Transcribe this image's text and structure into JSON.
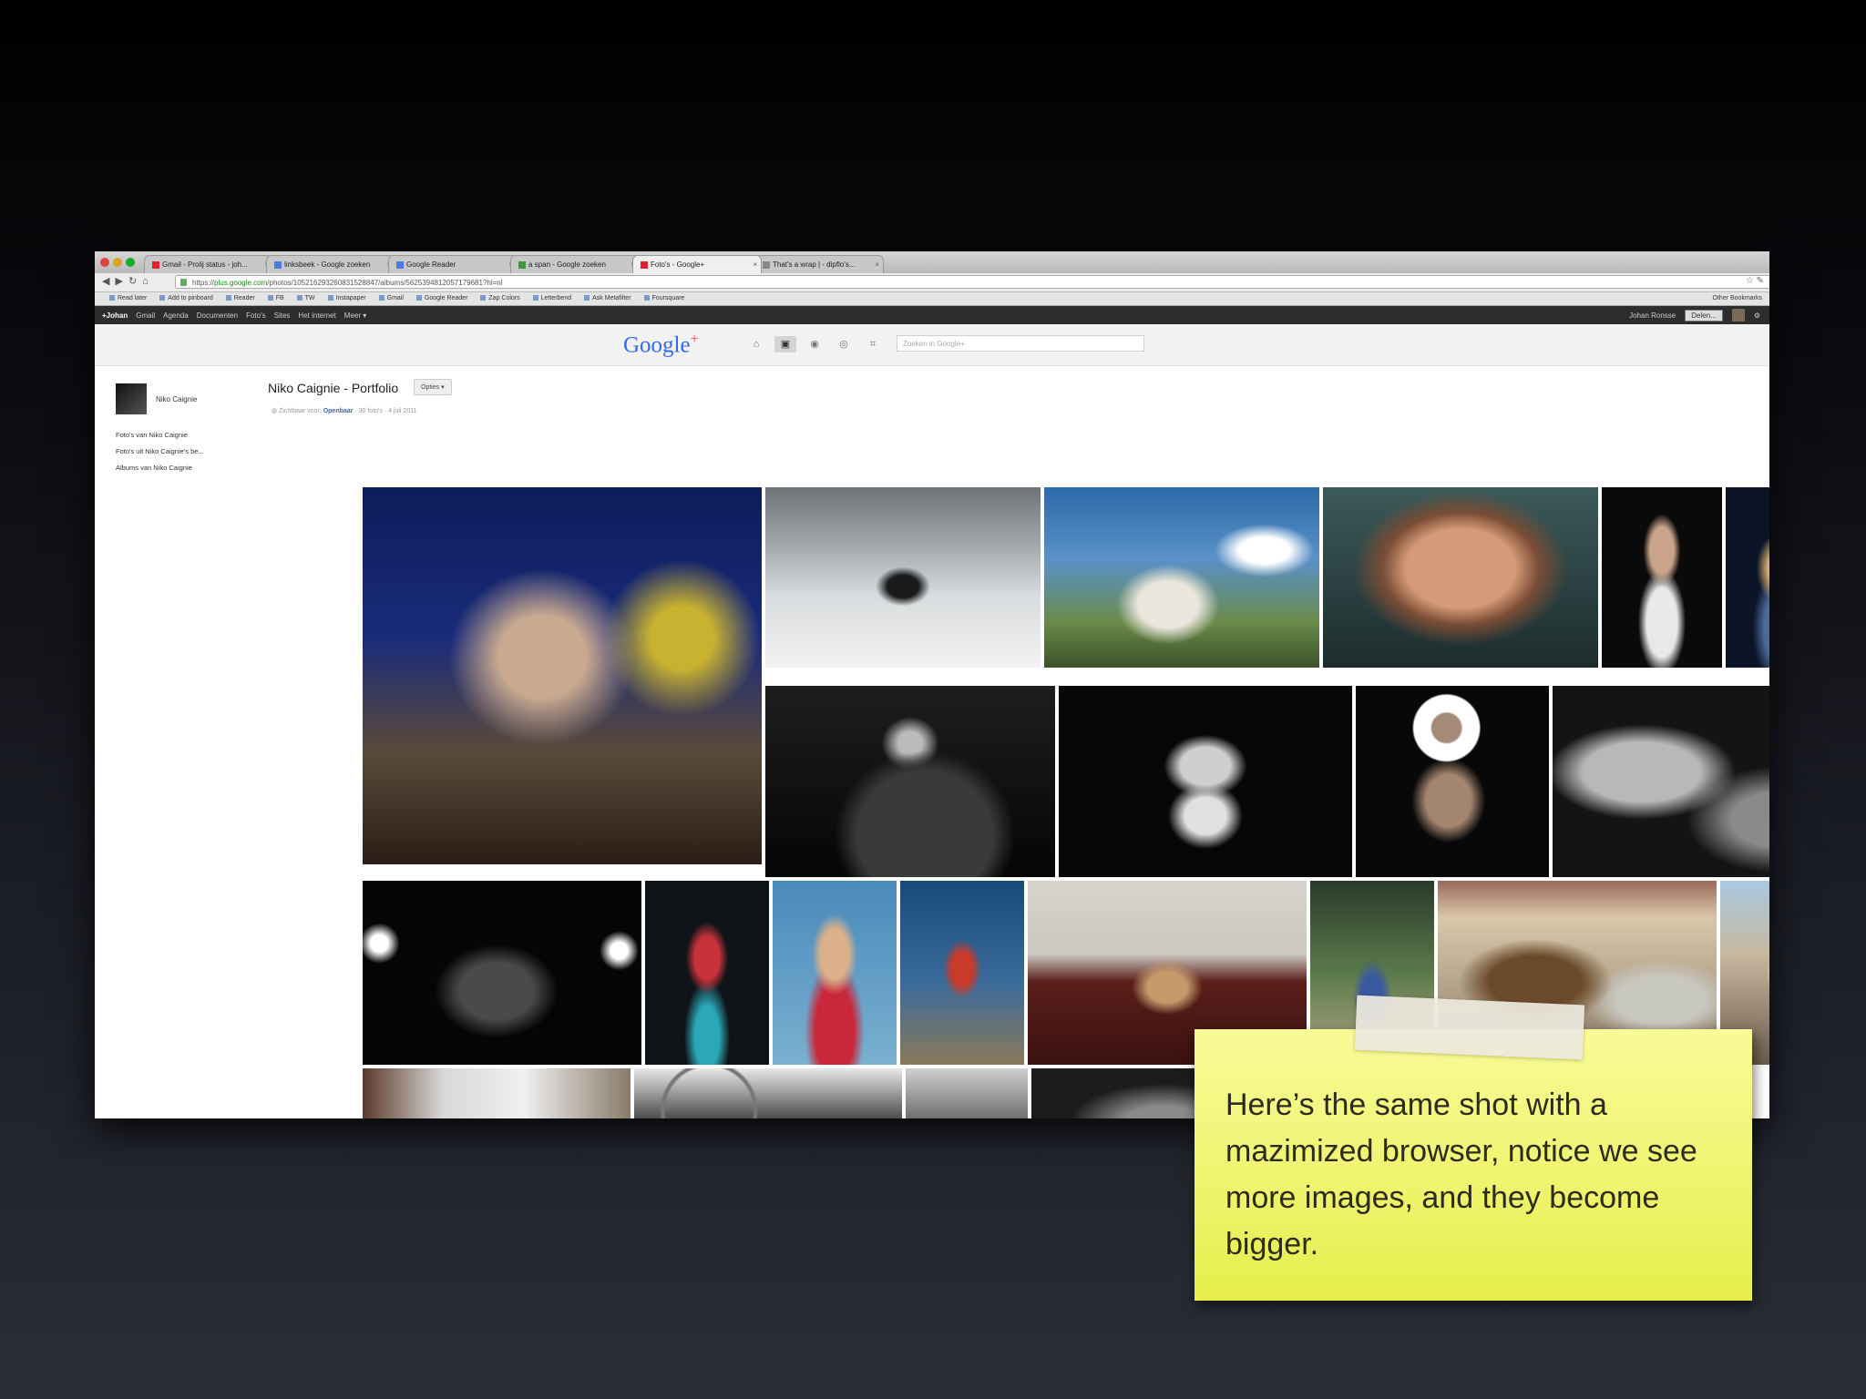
{
  "browser": {
    "tabs": [
      {
        "label": "Gmail - Prolij status - joh..."
      },
      {
        "label": "linksbeek - Google zoeken"
      },
      {
        "label": "Google Reader"
      },
      {
        "label": "a span - Google zoeken"
      },
      {
        "label": "Foto's - Google+"
      },
      {
        "label": "That's a wrap | - dipflo's..."
      }
    ],
    "url_scheme": "https://",
    "url_host": "plus.google.com",
    "url_path": "/photos/105216293260831528847/albums/5625394812057179681?hl=nl",
    "bookmarks": [
      "Read later",
      "Add to pinboard",
      "Reader",
      "FB",
      "TW",
      "Instapaper",
      "Gmail",
      "Google Reader",
      "Zap Colors",
      "Letterbend",
      "Ask Metafilter",
      "Foursquare"
    ],
    "other_bookmarks": "Other Bookmarks"
  },
  "gbar": {
    "links": [
      "+Johan",
      "Gmail",
      "Agenda",
      "Documenten",
      "Foto's",
      "Sites",
      "Het internet",
      "Meer ▾"
    ],
    "user": "Johan Ronsse",
    "share": "Delen..."
  },
  "gplus": {
    "logo": "Google",
    "logo_plus": "+",
    "search_placeholder": "Zoeken in Google+",
    "profile_name": "Niko Caignie",
    "left_links": [
      "Foto's van Niko Caignie",
      "Foto's uit Niko Caignie's be...",
      "Albums van Niko Caignie"
    ],
    "album_title": "Niko Caignie - Portfolio",
    "options_label": "Opties ▾",
    "meta_prefix": "Zichtbaar voor:",
    "meta_visibility": "Openbaar",
    "meta_count": "· 30 foto's ·",
    "meta_date": "4 juli 2011"
  },
  "note": {
    "text": "Here’s the same shot with a mazimized browser, notice we see more images, and they become bigger."
  },
  "colors": {
    "sticky": "#eff46f",
    "gbar": "#2d2d2d",
    "link_blue": "#3366cc"
  }
}
